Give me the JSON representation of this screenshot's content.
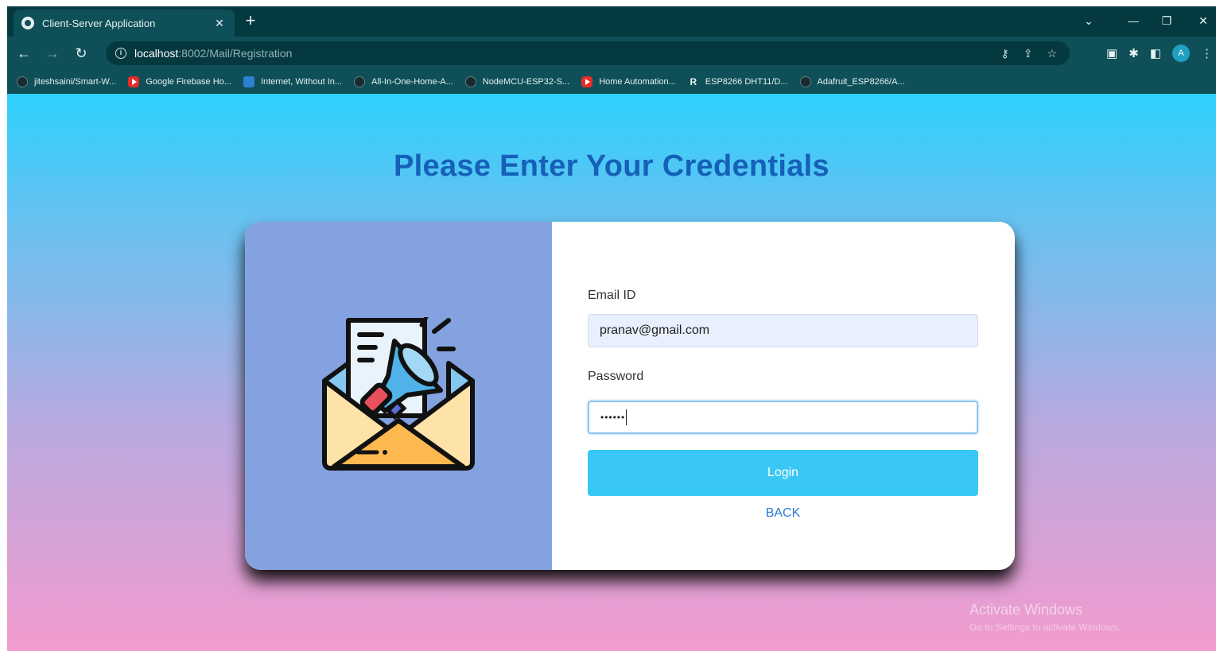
{
  "browser": {
    "tab_title": "Client-Server Application",
    "tab_close": "✕",
    "new_tab": "+",
    "url_host": "localhost",
    "url_path": ":8002/Mail/Registration",
    "bookmarks": [
      {
        "label": "jiteshsaini/Smart-W...",
        "icon": "github-icon"
      },
      {
        "label": "Google Firebase Ho...",
        "icon": "youtube-icon"
      },
      {
        "label": "Internet, Without In...",
        "icon": "doc-icon"
      },
      {
        "label": "All-In-One-Home-A...",
        "icon": "github-icon"
      },
      {
        "label": "NodeMCU-ESP32-S...",
        "icon": "github-icon"
      },
      {
        "label": "Home Automation...",
        "icon": "youtube-icon"
      },
      {
        "label": "ESP8266 DHT11/D...",
        "icon": "r-icon"
      },
      {
        "label": "Adafruit_ESP8266/A...",
        "icon": "github-icon"
      }
    ],
    "profile_initial": "A"
  },
  "page": {
    "title": "Please Enter Your Credentials",
    "email_label": "Email ID",
    "email_value": "pranav@gmail.com",
    "password_label": "Password",
    "password_value": "••••••",
    "login_label": "Login",
    "back_label": "BACK"
  },
  "watermark": {
    "line1": "Activate Windows",
    "line2": "Go to Settings to activate Windows."
  },
  "colors": {
    "title": "#1660b8",
    "login_button": "#39c8f5",
    "illustration_panel": "#84a2e0",
    "chrome": "#0e4f58"
  }
}
